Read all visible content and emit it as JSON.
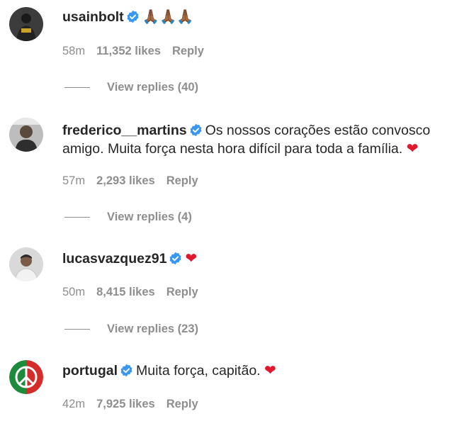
{
  "colors": {
    "text": "#262626",
    "muted": "#8e8e8e",
    "verified": "#3897f0",
    "heart": "#e0182d"
  },
  "comments": [
    {
      "username": "usainbolt",
      "verified": true,
      "text": "🙏🏾🙏🏾🙏🏾",
      "heart": "",
      "time": "58m",
      "likes": "11,352 likes",
      "reply": "Reply",
      "view_replies": "View replies (40)"
    },
    {
      "username": "frederico__martins",
      "verified": true,
      "text": "Os nossos corações estão convosco amigo. Muita força nesta hora difícil para toda a família.",
      "heart": "❤",
      "time": "57m",
      "likes": "2,293 likes",
      "reply": "Reply",
      "view_replies": "View replies (4)"
    },
    {
      "username": "lucasvazquez91",
      "verified": true,
      "text": "",
      "heart": "❤",
      "time": "50m",
      "likes": "8,415 likes",
      "reply": "Reply",
      "view_replies": "View replies (23)"
    },
    {
      "username": "portugal",
      "verified": true,
      "text": "Muita força, capitão.",
      "heart": "❤",
      "time": "42m",
      "likes": "7,925 likes",
      "reply": "Reply"
    }
  ]
}
